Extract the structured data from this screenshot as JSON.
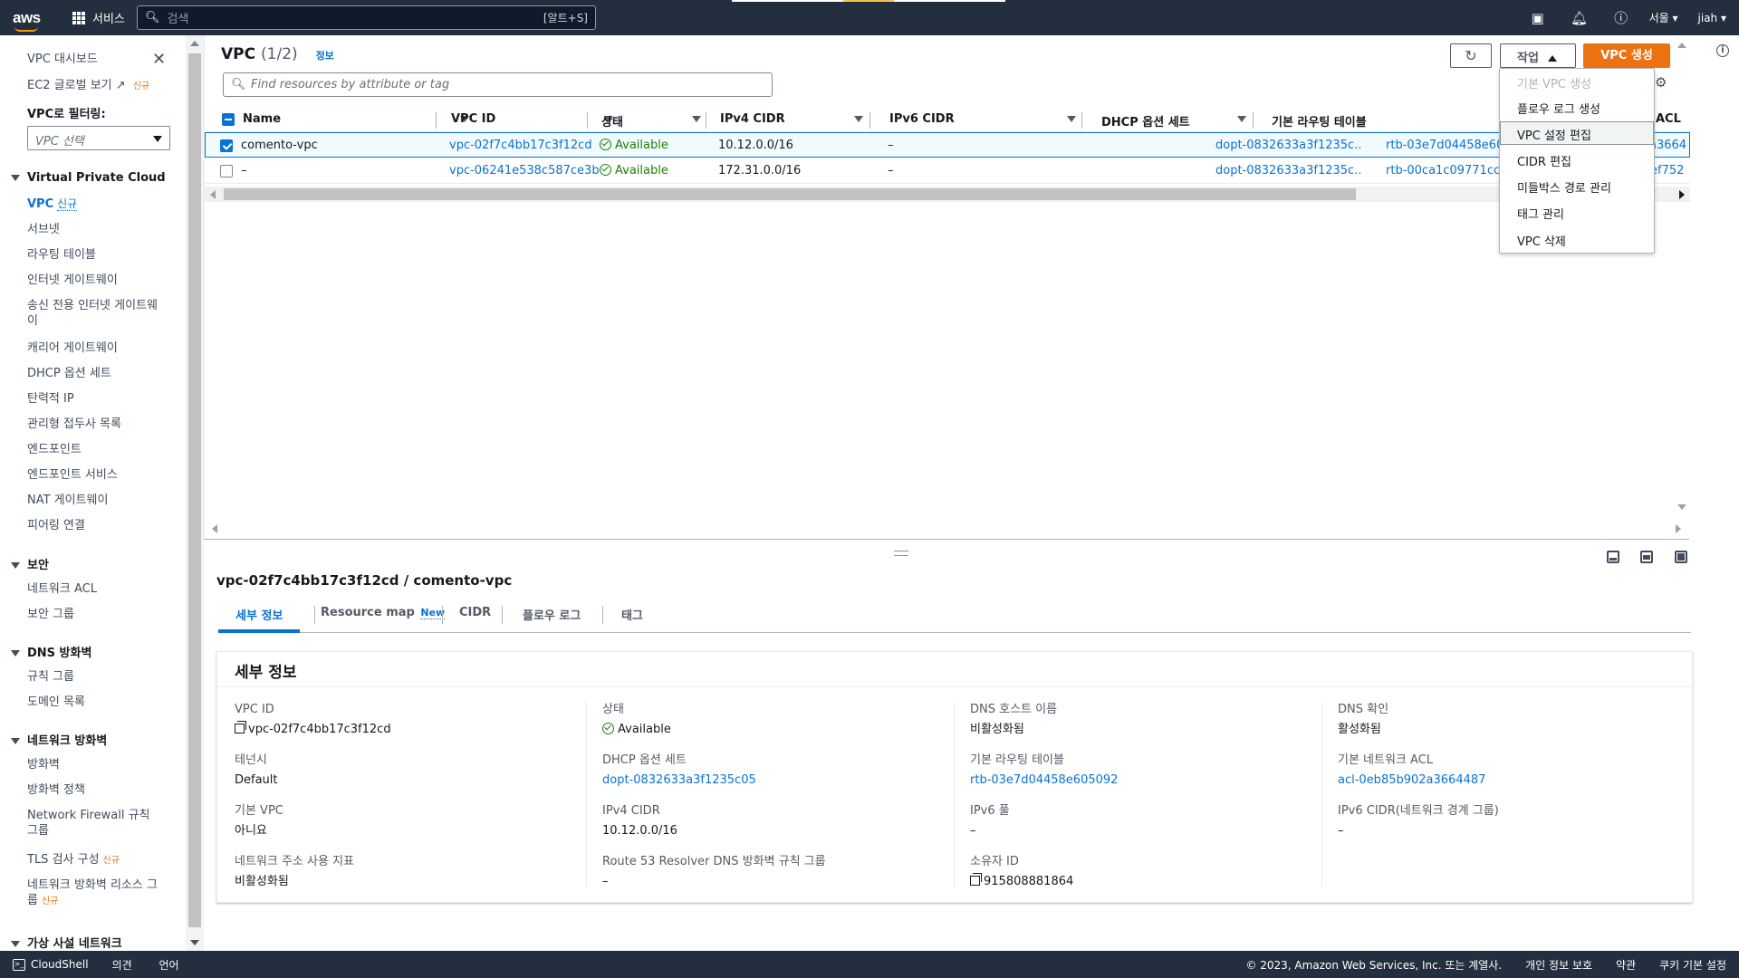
{
  "topnav": {
    "logo": "aws",
    "services_label": "서비스",
    "search_placeholder": "검색",
    "search_shortcut": "[알트+S]",
    "region": "서울 ▾",
    "user": "jiah ▾"
  },
  "sidebar": {
    "top_items": [
      "VPC 대시보드",
      "EC2 글로벌 보기"
    ],
    "new_badge": "신규",
    "filter_label": "VPC로 필터링:",
    "filter_placeholder": "VPC 선택",
    "sections": [
      {
        "title": "Virtual Private Cloud",
        "items": [
          "VPC",
          "서브넷",
          "라우팅 테이블",
          "인터넷 게이트웨이",
          "송신 전용 인터넷 게이트웨이",
          "캐리어 게이트웨이",
          "DHCP 옵션 세트",
          "탄력적 IP",
          "관리형 접두사 목록",
          "엔드포인트",
          "엔드포인트 서비스",
          "NAT 게이트웨이",
          "피어링 연결"
        ]
      },
      {
        "title": "보안",
        "items": [
          "네트워크 ACL",
          "보안 그룹"
        ]
      },
      {
        "title": "DNS 방화벽",
        "items": [
          "규칙 그룹",
          "도메인 목록"
        ]
      },
      {
        "title": "네트워크 방화벽",
        "items": [
          "방화벽",
          "방화벽 정책",
          "Network Firewall 규칙 그룹",
          "TLS 검사 구성",
          "네트워크 방화벽 리소스 그룹"
        ]
      },
      {
        "title": "가상 사설 네트워크",
        "items": []
      }
    ]
  },
  "main": {
    "title": "VPC",
    "count": "(1/2)",
    "info": "정보",
    "search_placeholder": "Find resources by attribute or tag",
    "actions_label": "작업",
    "create_label": "VPC 생성",
    "columns": [
      "Name",
      "VPC ID",
      "상태",
      "IPv4 CIDR",
      "IPv6 CIDR",
      "DHCP 옵션 세트",
      "기본 라우팅 테이블",
      "ACL"
    ],
    "rows": [
      {
        "name": "comento-vpc",
        "vpc_id": "vpc-02f7c4bb17c3f12cd",
        "status": "Available",
        "ipv4": "10.12.0.0/16",
        "ipv6": "–",
        "dhcp": "dopt-0832633a3f1235c...",
        "rtb": "rtb-03e7d04458e605",
        "acl": "a3664"
      },
      {
        "name": "–",
        "vpc_id": "vpc-06241e538c587ce3b",
        "status": "Available",
        "ipv4": "172.31.0.0/16",
        "ipv6": "–",
        "dhcp": "dopt-0832633a3f1235c...",
        "rtb": "rtb-00ca1c09771cce4",
        "acl": "ef752"
      }
    ]
  },
  "dropdown": {
    "items": [
      "기본 VPC 생성",
      "플로우 로그 생성",
      "VPC 설정 편집",
      "CIDR 편집",
      "미들박스 경로 관리",
      "태그 관리",
      "VPC 삭제"
    ]
  },
  "split": {
    "title": "vpc-02f7c4bb17c3f12cd / comento-vpc",
    "tabs": [
      "세부 정보",
      "Resource map",
      "CIDR",
      "플로우 로그",
      "태그"
    ],
    "tab_new": "New",
    "details_title": "세부 정보",
    "fields": [
      [
        {
          "k": "VPC ID",
          "v": "vpc-02f7c4bb17c3f12cd"
        },
        {
          "k": "테넌시",
          "v": "Default"
        },
        {
          "k": "기본 VPC",
          "v": "아니요"
        },
        {
          "k": "네트워크 주소 사용 지표",
          "v": "비활성화됨"
        }
      ],
      [
        {
          "k": "상태",
          "v": "Available"
        },
        {
          "k": "DHCP 옵션 세트",
          "v": "dopt-0832633a3f1235c05"
        },
        {
          "k": "IPv4 CIDR",
          "v": "10.12.0.0/16"
        },
        {
          "k": "Route 53 Resolver DNS 방화벽 규칙 그룹",
          "v": "–"
        }
      ],
      [
        {
          "k": "DNS 호스트 이름",
          "v": "비활성화됨"
        },
        {
          "k": "기본 라우팅 테이블",
          "v": "rtb-03e7d04458e605092"
        },
        {
          "k": "IPv6 풀",
          "v": "–"
        },
        {
          "k": "소유자 ID",
          "v": "915808881864"
        }
      ],
      [
        {
          "k": "DNS 확인",
          "v": "활성화됨"
        },
        {
          "k": "기본 네트워크 ACL",
          "v": "acl-0eb85b902a3664487"
        },
        {
          "k": "IPv6 CIDR(네트워크 경계 그룹)",
          "v": "–"
        }
      ]
    ]
  },
  "footer": {
    "cloudshell": "CloudShell",
    "feedback": "의견",
    "language": "언어",
    "copyright": "© 2023, Amazon Web Services, Inc. 또는 계열사.",
    "privacy": "개인 정보 보호",
    "terms": "약관",
    "cookies": "쿠키 기본 설정"
  }
}
